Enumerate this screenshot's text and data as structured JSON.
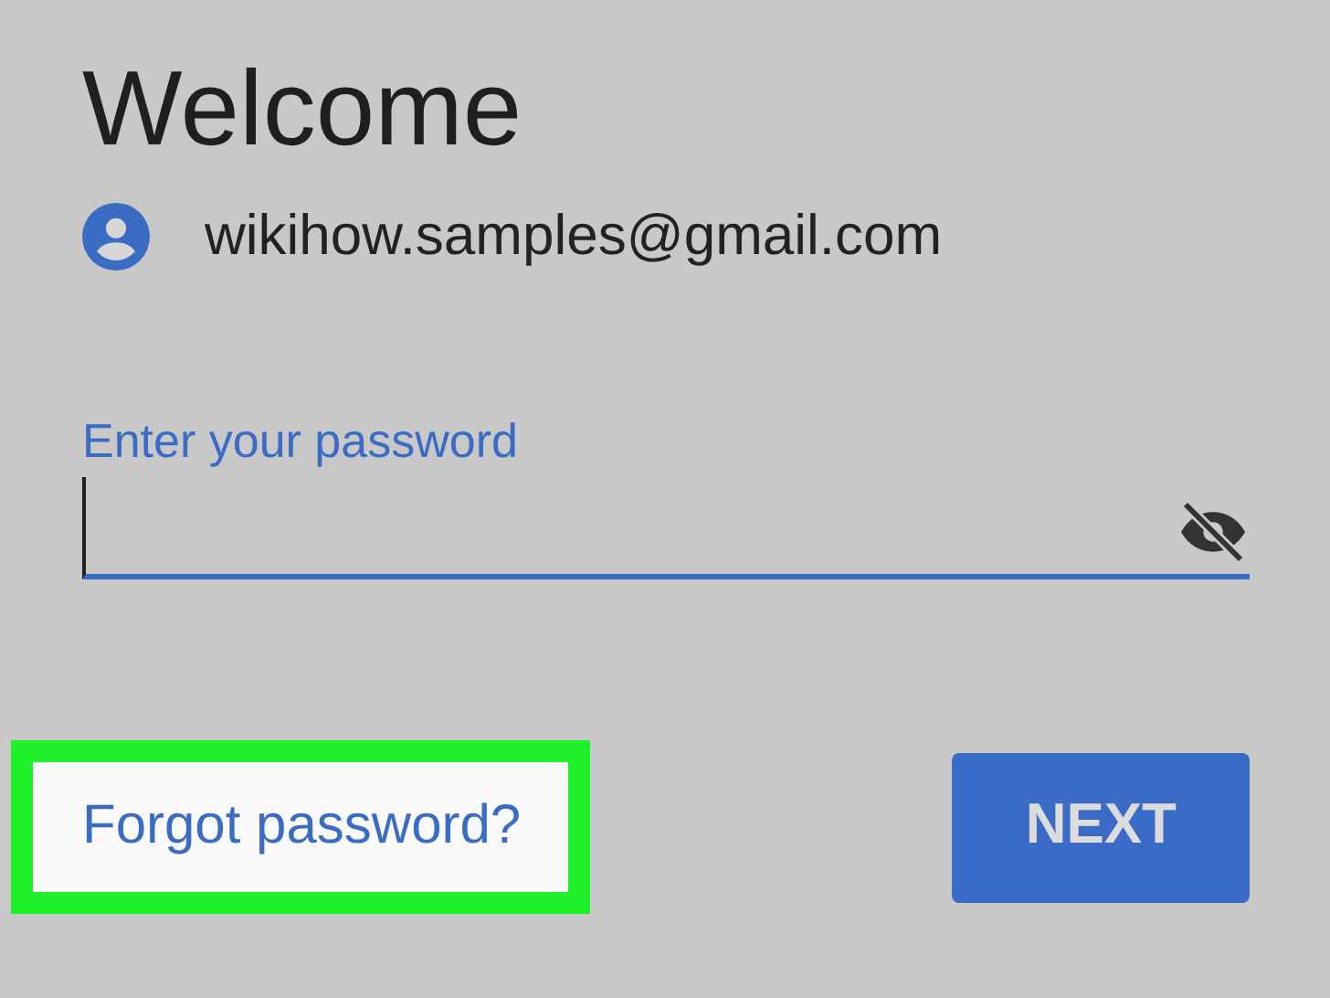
{
  "title": "Welcome",
  "account": {
    "email": "wikihow.samples@gmail.com"
  },
  "password_field": {
    "label": "Enter your password"
  },
  "forgot_link": {
    "label": "Forgot password?",
    "highlighted": true
  },
  "next_button": {
    "label": "NEXT"
  }
}
